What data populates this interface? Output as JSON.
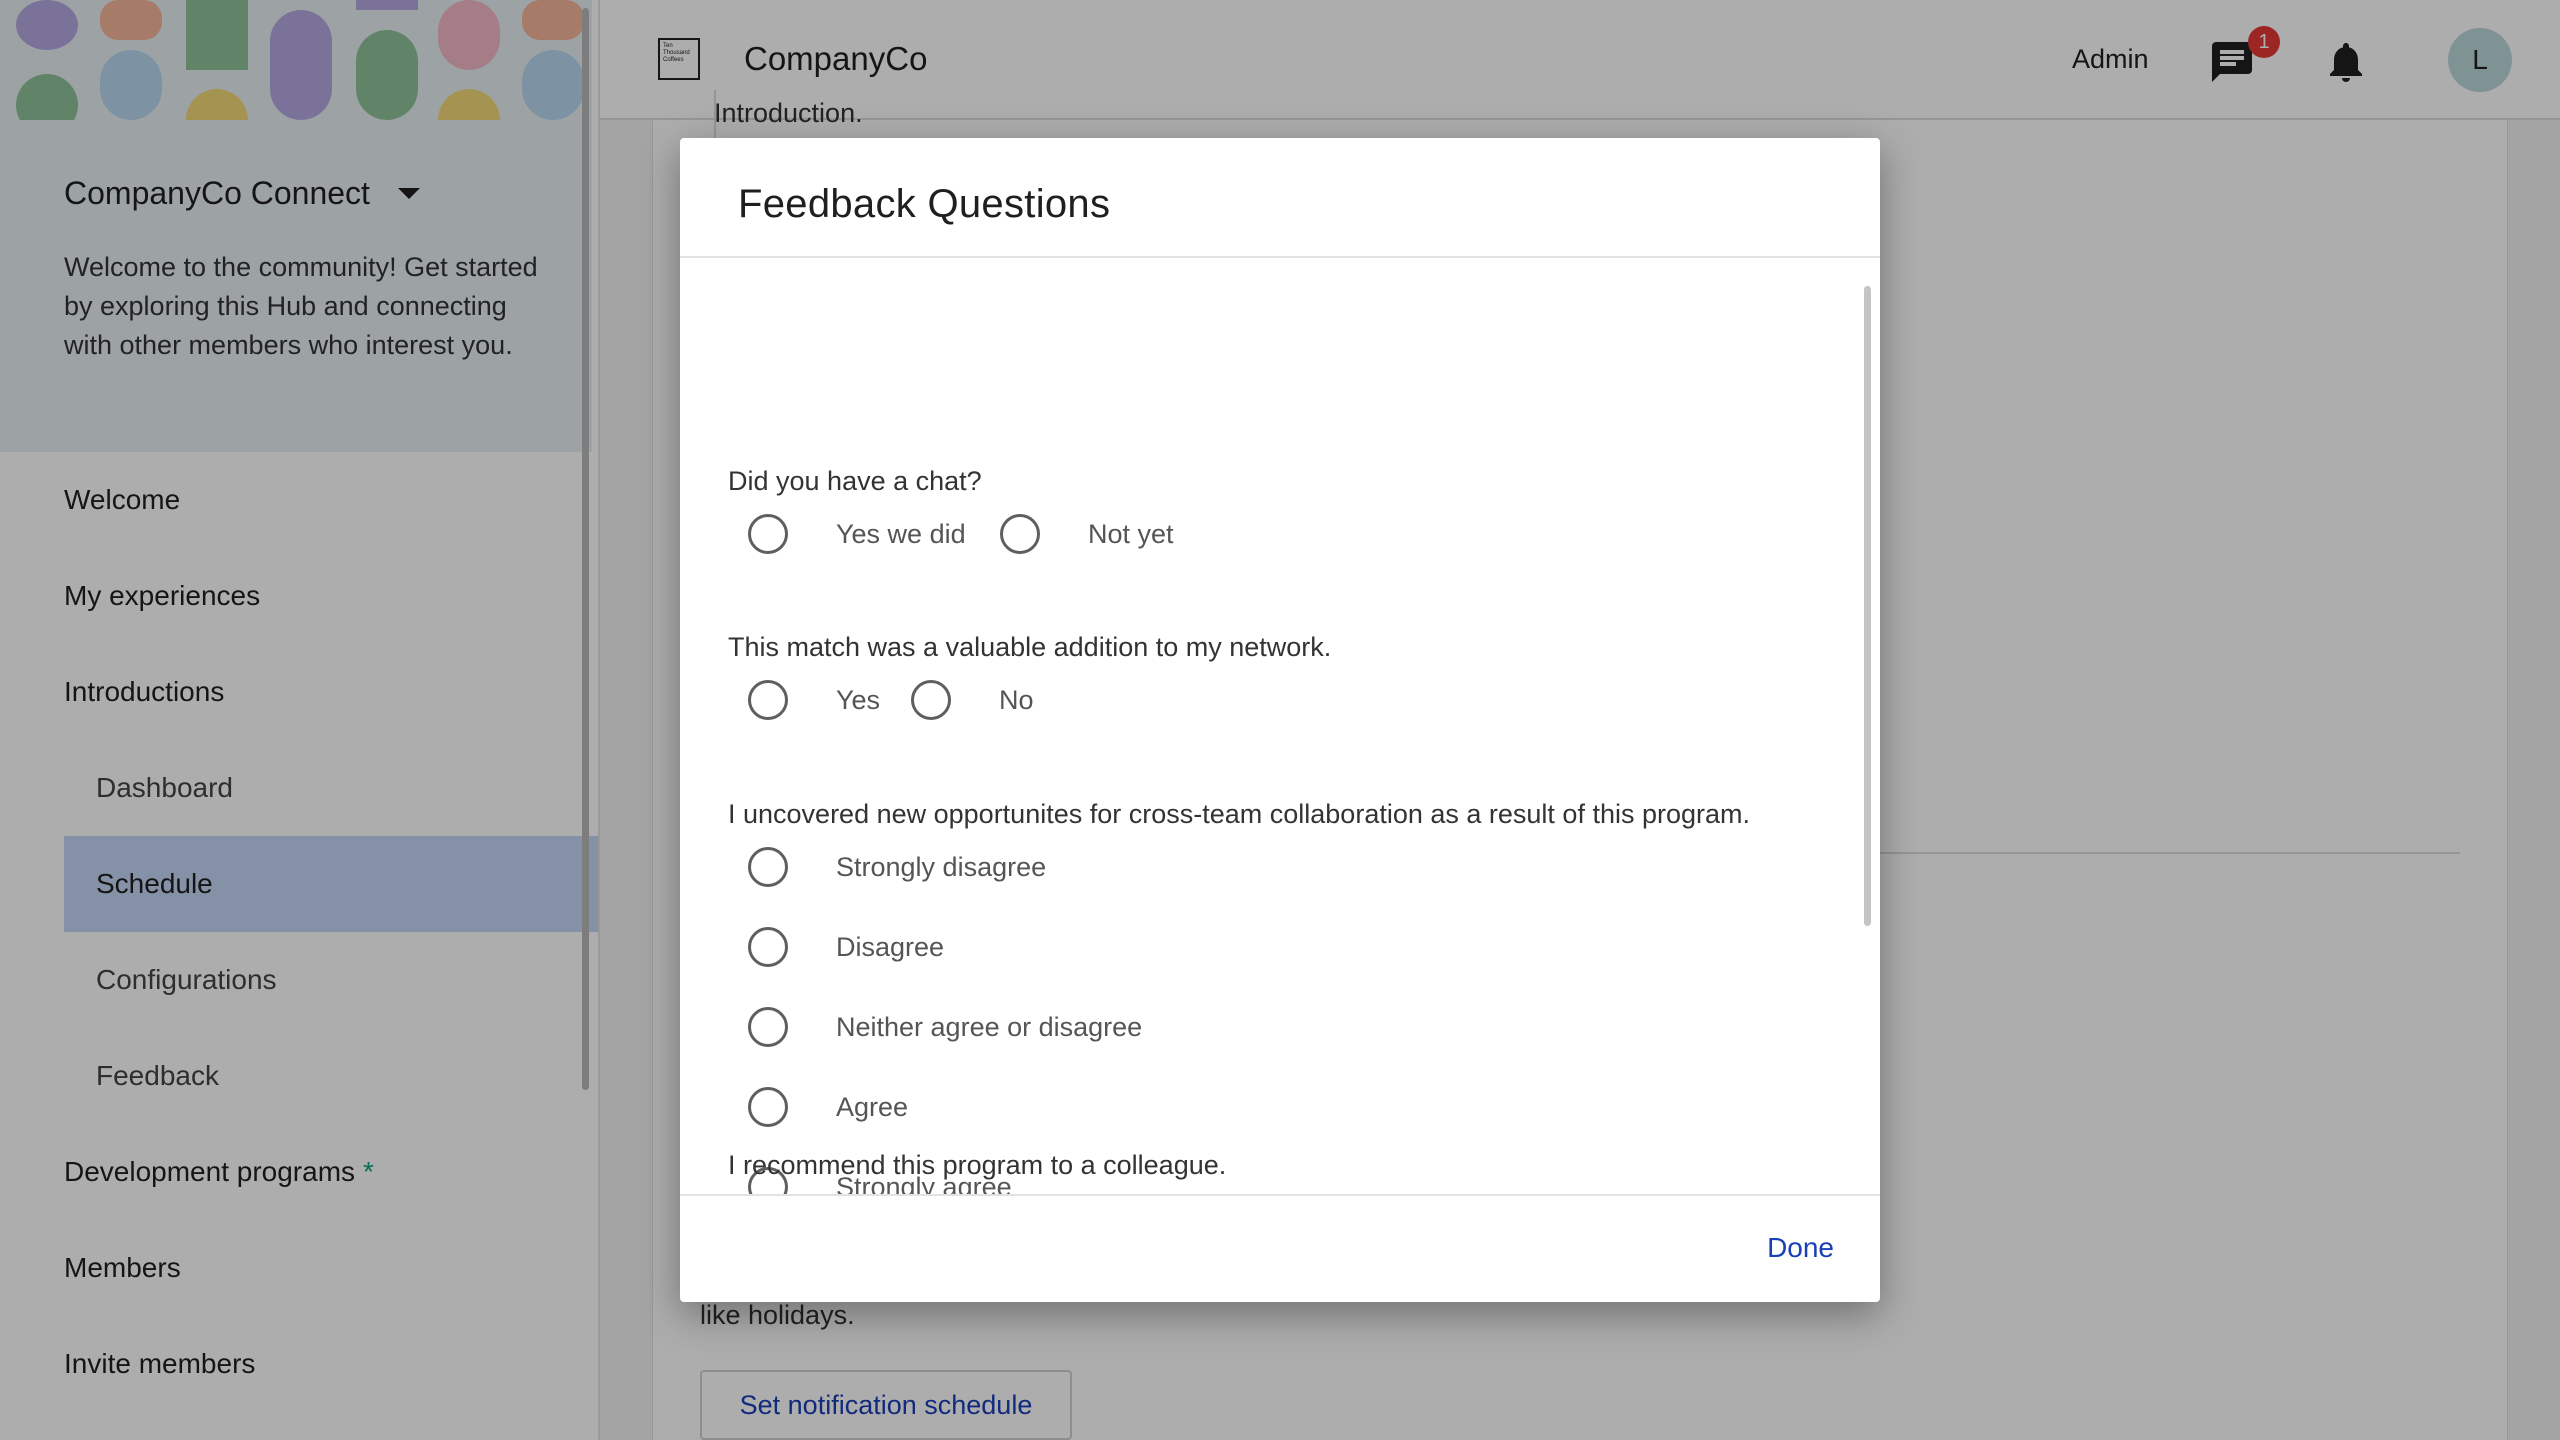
{
  "sidebar": {
    "hub_name": "CompanyCo Connect",
    "hub_description": "Welcome to the community! Get started by exploring this Hub and connecting with other members who interest you.",
    "items": [
      {
        "label": "Welcome"
      },
      {
        "label": "My experiences"
      },
      {
        "label": "Introductions"
      },
      {
        "label": "Dashboard"
      },
      {
        "label": "Schedule"
      },
      {
        "label": "Configurations"
      },
      {
        "label": "Feedback"
      },
      {
        "label": "Development programs"
      },
      {
        "label": "Members"
      },
      {
        "label": "Invite members"
      }
    ],
    "active_item": "Schedule",
    "new_marker": "*"
  },
  "topbar": {
    "logo_text": "Ten Thousand Coffees",
    "brand": "CompanyCo",
    "admin_label": "Admin",
    "chat_badge": "1",
    "avatar_initial": "L",
    "chat_icon": "chat-icon",
    "bell_icon": "bell-icon"
  },
  "background": {
    "intro_fragment": "Introduction.",
    "text_fragment": "like holidays.",
    "button_label": "Set notification schedule"
  },
  "dialog": {
    "title": "Feedback Questions",
    "questions": [
      {
        "label": "Did you have a chat?",
        "options": [
          "Yes we did",
          "Not yet"
        ]
      },
      {
        "label": "This match was a valuable addition to my network.",
        "options": [
          "Yes",
          "No"
        ]
      },
      {
        "label": "I uncovered new opportunites for cross-team collaboration as a result of this program.",
        "options": [
          "Strongly disagree",
          "Disagree",
          "Neither agree or disagree",
          "Agree",
          "Strongly agree"
        ]
      },
      {
        "label": "I recommend this program to a colleague.",
        "options": []
      }
    ],
    "done_label": "Done"
  },
  "colors": {
    "accent": "#1a3fb8",
    "active_nav": "#c5d6f5",
    "badge": "#e53935",
    "new_marker": "#16a085"
  }
}
